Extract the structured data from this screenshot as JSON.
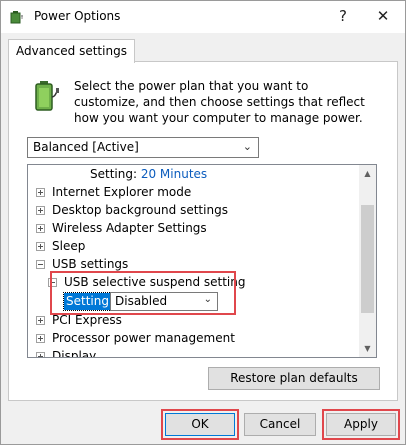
{
  "window": {
    "title": "Power Options"
  },
  "tab": {
    "label": "Advanced settings"
  },
  "intro": {
    "text": "Select the power plan that you want to customize, and then choose settings that reflect how you want your computer to manage power."
  },
  "plan": {
    "selected": "Balanced [Active]"
  },
  "tree": {
    "top_setting_label": "Setting:",
    "top_setting_value": "20 Minutes",
    "items": {
      "internet_explorer": "Internet Explorer mode",
      "desktop_background": "Desktop background settings",
      "wireless_adapter": "Wireless Adapter Settings",
      "sleep": "Sleep",
      "usb": "USB settings",
      "usb_selective": "USB selective suspend setting",
      "pci_express": "PCI Express",
      "processor": "Processor power management",
      "display": "Display"
    },
    "usb_setting_label": "Setting:",
    "usb_setting_value": "Disabled"
  },
  "buttons": {
    "restore": "Restore plan defaults",
    "ok": "OK",
    "cancel": "Cancel",
    "apply": "Apply"
  },
  "colors": {
    "highlight_box": "#e0474c",
    "selection": "#0078d7",
    "link_blue": "#0b5cbd"
  }
}
